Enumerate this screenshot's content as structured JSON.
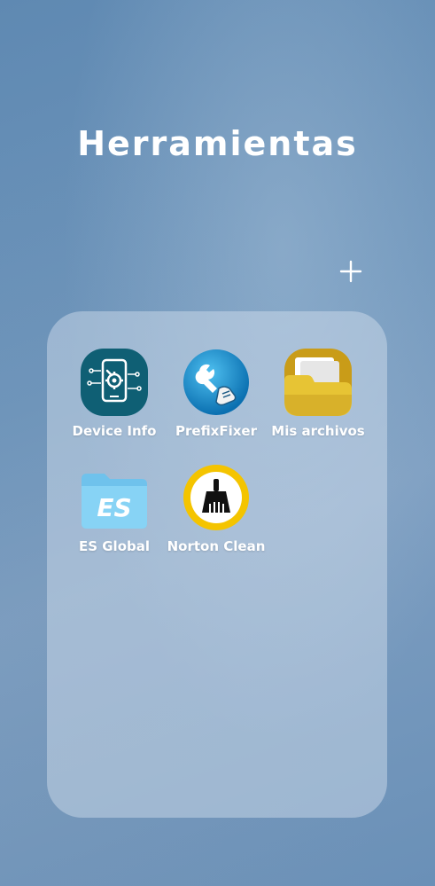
{
  "folder": {
    "title": "Herramientas",
    "add_label": "+"
  },
  "apps": [
    {
      "label": "Device Info",
      "icon": "device-info-icon"
    },
    {
      "label": "PrefixFixer",
      "icon": "wrench-hand-icon"
    },
    {
      "label": "Mis archivos",
      "icon": "folder-icon"
    },
    {
      "label": "ES Global",
      "icon": "es-folder-icon"
    },
    {
      "label": "Norton Clean",
      "icon": "broom-icon"
    }
  ],
  "colors": {
    "background": "#6a90b7",
    "panel": "#aabfd6",
    "device_info_bg": "#0f5f74",
    "prefixfixer_bg": "#1e8fcf",
    "mis_archivos": "#d9b227",
    "es_global": "#7fcdf2",
    "norton": "#f4c400"
  }
}
